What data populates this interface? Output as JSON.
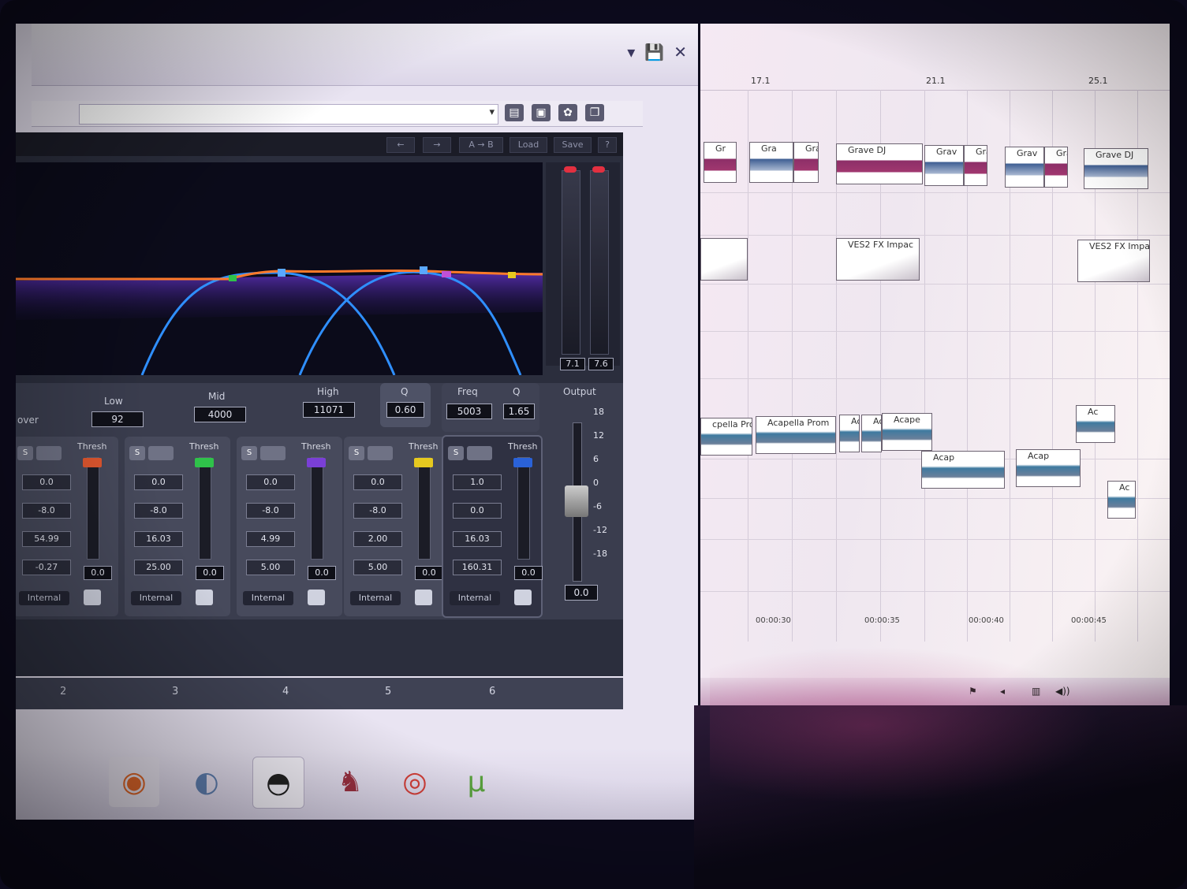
{
  "plugin": {
    "bar_buttons": [
      "←",
      "→",
      "A → B",
      "Load",
      "Save",
      "?"
    ],
    "section_label": "over",
    "crossover": {
      "low_label": "Low",
      "low_value": "92",
      "mid_label": "Mid",
      "mid_value": "4000",
      "high_label": "High",
      "high_value": "11071",
      "q_label": "Q",
      "q_value": "0.60"
    },
    "band6_header": {
      "freq_label": "Freq",
      "freq_value": "5003",
      "q_label": "Q",
      "q_value": "1.65"
    },
    "meters": {
      "left": "7.1",
      "right": "7.6"
    },
    "bands": [
      {
        "id": "2",
        "thresh_label": "Thresh",
        "values": [
          "0.0",
          "-8.0",
          "54.99",
          "-0.27"
        ],
        "fader_value": "0.0",
        "mode": "Internal",
        "color": "#e0572f"
      },
      {
        "id": "3",
        "thresh_label": "Thresh",
        "values": [
          "0.0",
          "-8.0",
          "16.03",
          "25.00"
        ],
        "fader_value": "0.0",
        "mode": "Internal",
        "color": "#2fc24a"
      },
      {
        "id": "4",
        "thresh_label": "Thresh",
        "values": [
          "0.0",
          "-8.0",
          "4.99",
          "5.00"
        ],
        "fader_value": "0.0",
        "mode": "Internal",
        "color": "#7a3fd6"
      },
      {
        "id": "5",
        "thresh_label": "Thresh",
        "values": [
          "0.0",
          "-8.0",
          "2.00",
          "5.00"
        ],
        "fader_value": "0.0",
        "mode": "Internal",
        "color": "#e6c91f"
      },
      {
        "id": "6",
        "thresh_label": "Thresh",
        "values": [
          "1.0",
          "0.0",
          "16.03",
          "160.31"
        ],
        "fader_value": "0.0",
        "mode": "Internal",
        "color": "#2a62d8"
      }
    ],
    "output": {
      "label": "Output",
      "scale": [
        "18",
        "12",
        "6",
        "0",
        "-6",
        "-12",
        "-18"
      ],
      "value": "0.0"
    }
  },
  "taskbar": {
    "items": [
      "firefox-icon",
      "paint-icon",
      "media-player-icon",
      "app-icon",
      "chrome-icon",
      "utorrent-icon"
    ]
  },
  "daw": {
    "markers": [
      "17.1",
      "21.1",
      "25.1"
    ],
    "clips": [
      {
        "label": "Gr",
        "kind": "dj"
      },
      {
        "label": "Gra",
        "kind": "dj2"
      },
      {
        "label": "Gra",
        "kind": "dj"
      },
      {
        "label": "Grave DJ",
        "kind": "dj"
      },
      {
        "label": "Grav",
        "kind": "dj2"
      },
      {
        "label": "Gra",
        "kind": "dj"
      },
      {
        "label": "Grav",
        "kind": "dj2"
      },
      {
        "label": "Gra",
        "kind": "dj"
      },
      {
        "label": "Grave DJ",
        "kind": "dj2"
      },
      {
        "label": "VES2 FX Impac",
        "kind": "fx"
      },
      {
        "label": "VES2 FX Impac",
        "kind": "fx"
      },
      {
        "label": "cpella Prom",
        "kind": "acap"
      },
      {
        "label": "Acapella Prom",
        "kind": "acap"
      },
      {
        "label": "Ac",
        "kind": "acap"
      },
      {
        "label": "Ac",
        "kind": "acap"
      },
      {
        "label": "Acape",
        "kind": "acap"
      },
      {
        "label": "Acap",
        "kind": "acap"
      },
      {
        "label": "Acap",
        "kind": "acap"
      },
      {
        "label": "Ac",
        "kind": "acap"
      },
      {
        "label": "Ac",
        "kind": "acap"
      }
    ],
    "timecodes": [
      "00:00:30",
      "00:00:35",
      "00:00:40",
      "00:00:45"
    ]
  }
}
